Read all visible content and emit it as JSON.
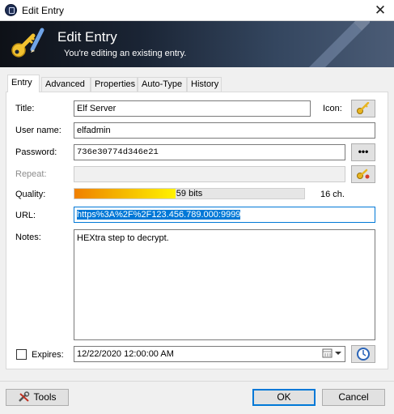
{
  "window": {
    "title": "Edit Entry"
  },
  "banner": {
    "title": "Edit Entry",
    "subtitle": "You're editing an existing entry."
  },
  "tabs": [
    {
      "label": "Entry",
      "active": true
    },
    {
      "label": "Advanced"
    },
    {
      "label": "Properties"
    },
    {
      "label": "Auto-Type"
    },
    {
      "label": "History"
    }
  ],
  "form": {
    "title_label": "Title:",
    "title_value": "Elf Server",
    "icon_label": "Icon:",
    "username_label": "User name:",
    "username_value": "elfadmin",
    "password_label": "Password:",
    "password_value": "736e30774d346e21",
    "show_password_glyph": "•••",
    "repeat_label": "Repeat:",
    "quality_label": "Quality:",
    "quality_text": "59 bits",
    "quality_fraction": 0.44,
    "char_count": "16 ch.",
    "url_label": "URL:",
    "url_value": "https%3A%2F%2F123.456.789.000:9999",
    "notes_label": "Notes:",
    "notes_value": "HEXtra step to decrypt.",
    "expires_label": "Expires:",
    "expires_checked": false,
    "expires_value": "12/22/2020 12:00:00 AM"
  },
  "footer": {
    "tools_label": "Tools",
    "ok_label": "OK",
    "cancel_label": "Cancel"
  },
  "colors": {
    "accent": "#0078d7",
    "quality_start": "#f08000",
    "quality_end": "#fff200"
  },
  "icons": {
    "app": "keepass-lock-icon",
    "banner": "key-pencil-icon",
    "entry_icon": "key-icon",
    "password_generator": "key-generator-icon",
    "expiry_presets": "clock-icon",
    "calendar": "calendar-icon",
    "tools": "tools-icon"
  }
}
